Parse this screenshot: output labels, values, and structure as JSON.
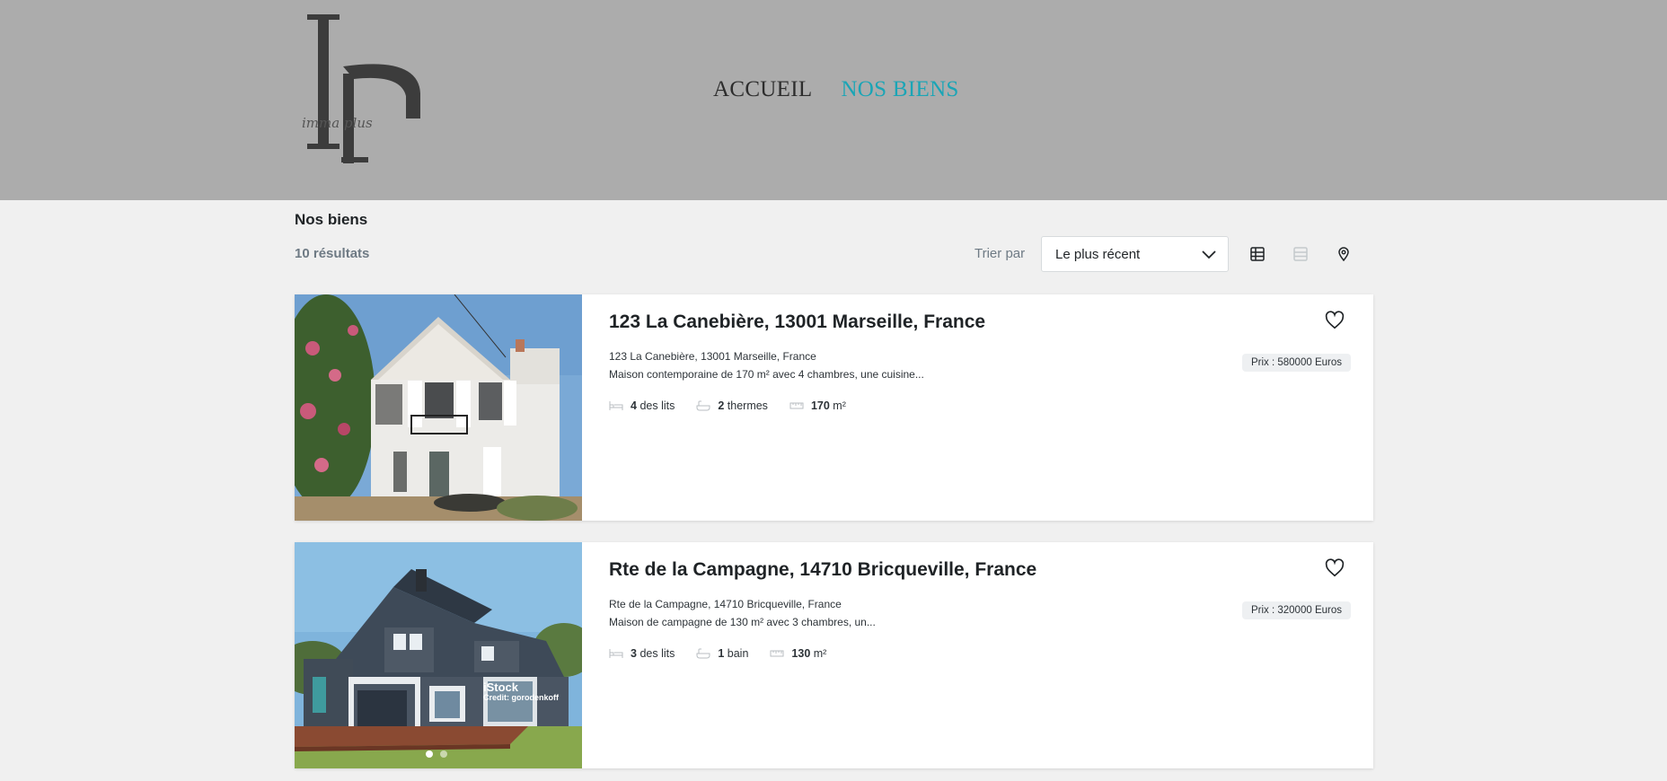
{
  "header": {
    "logo_text": "imma plus",
    "nav": [
      {
        "label": "ACCUEIL",
        "active": false
      },
      {
        "label": "NOS BIENS",
        "active": true
      }
    ],
    "accent": "#1aa5b6",
    "background": "#acacac"
  },
  "toolbar": {
    "page_title": "Nos biens",
    "results": "10 résultats",
    "sort_label": "Trier par",
    "sort_value": "Le plus récent",
    "views": [
      {
        "icon": "grid-view-icon",
        "active": true
      },
      {
        "icon": "list-view-icon",
        "active": false
      },
      {
        "icon": "map-pin-icon",
        "active": false
      }
    ]
  },
  "listings": [
    {
      "title": "123 La Canebière, 13001 Marseille, France",
      "address": "123 La Canebière, 13001 Marseille, France",
      "description": "Maison contemporaine de 170 m² avec 4 chambres, une cuisine...",
      "beds_count": "4",
      "beds_label": "des lits",
      "baths_count": "2",
      "baths_label": "thermes",
      "area_value": "170",
      "area_unit": "m²",
      "price": "Prix : 580000 Euros"
    },
    {
      "title": "Rte de la Campagne, 14710 Bricqueville, France",
      "address": "Rte de la Campagne, 14710 Bricqueville, France",
      "description": "Maison de campagne de 130 m² avec 3 chambres, un...",
      "beds_count": "3",
      "beds_label": "des lits",
      "baths_count": "1",
      "baths_label": "bain",
      "area_value": "130",
      "area_unit": "m²",
      "price": "Prix : 320000 Euros",
      "watermark_brand": "iStock",
      "watermark_credit": "Credit: gorodenkoff"
    }
  ]
}
